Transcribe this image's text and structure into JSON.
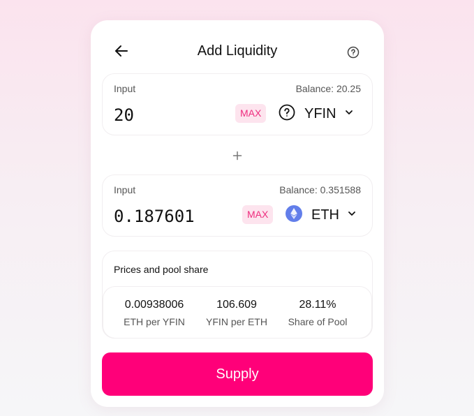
{
  "header": {
    "title": "Add Liquidity",
    "back_icon": "arrow-left-icon",
    "help_icon": "question-circle-icon"
  },
  "input_a": {
    "label": "Input",
    "balance": "Balance: 20.25",
    "amount": "20",
    "max_label": "MAX",
    "token": "YFIN",
    "token_icon": "question-circle-icon"
  },
  "separator_icon": "plus-icon",
  "input_b": {
    "label": "Input",
    "balance": "Balance: 0.351588",
    "amount": "0.187601",
    "max_label": "MAX",
    "token": "ETH",
    "token_icon": "ethereum-icon"
  },
  "pool": {
    "title": "Prices and pool share",
    "stats": [
      {
        "value": "0.00938006",
        "label": "ETH per YFIN"
      },
      {
        "value": "106.609",
        "label": "YFIN per ETH"
      },
      {
        "value": "28.11%",
        "label": "Share of Pool"
      }
    ]
  },
  "supply_label": "Supply",
  "colors": {
    "accent": "#ff0079",
    "max_bg": "#fde4ee",
    "max_text": "#ee2d7e",
    "eth": "#627eea"
  }
}
